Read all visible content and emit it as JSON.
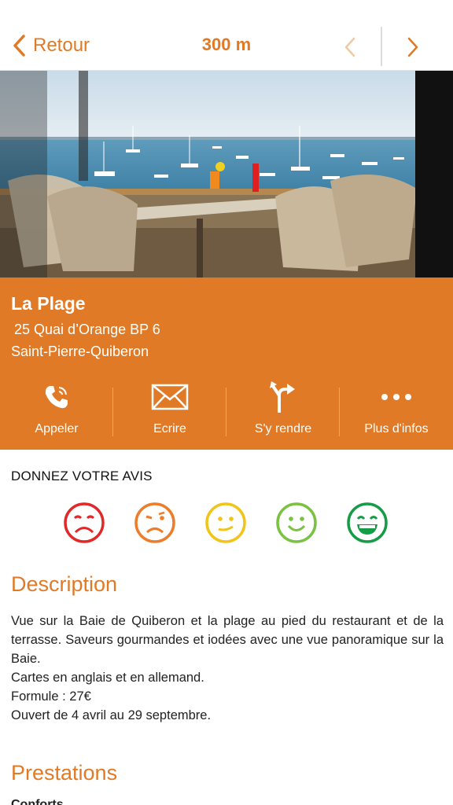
{
  "colors": {
    "accent": "#e07a26",
    "white": "#ffffff"
  },
  "topbar": {
    "back_label": "Retour",
    "distance": "300 m",
    "prev_icon": "chevron-left-icon",
    "next_icon": "chevron-right-icon"
  },
  "place": {
    "name": "La Plage",
    "address_line1": "25 Quai d’Orange BP 6",
    "address_line2": "Saint-Pierre-Quiberon"
  },
  "actions": [
    {
      "label": "Appeler",
      "icon": "phone-icon"
    },
    {
      "label": "Ecrire",
      "icon": "envelope-icon"
    },
    {
      "label": "S'y rendre",
      "icon": "directions-icon"
    },
    {
      "label": "Plus d'infos",
      "icon": "more-icon"
    }
  ],
  "rating": {
    "title": "DONNEZ VOTRE AVIS",
    "options": [
      {
        "icon": "very-unhappy-face-icon",
        "color": "#e02a2a"
      },
      {
        "icon": "unhappy-face-icon",
        "color": "#ec7d2c"
      },
      {
        "icon": "neutral-face-icon",
        "color": "#f0c419"
      },
      {
        "icon": "happy-face-icon",
        "color": "#7cc242"
      },
      {
        "icon": "very-happy-face-icon",
        "color": "#169b47"
      }
    ]
  },
  "description": {
    "title": "Description",
    "lines": [
      "Vue sur la Baie de Quiberon et la plage au pied du restaurant et de la terrasse. Saveurs gourmandes et iodées avec une vue panoramique sur la Baie.",
      "Cartes en anglais et en allemand.",
      "Formule : 27€",
      "Ouvert de 4 avril au 29 septembre."
    ]
  },
  "prestations": {
    "title": "Prestations",
    "first_item": "Conforts"
  }
}
